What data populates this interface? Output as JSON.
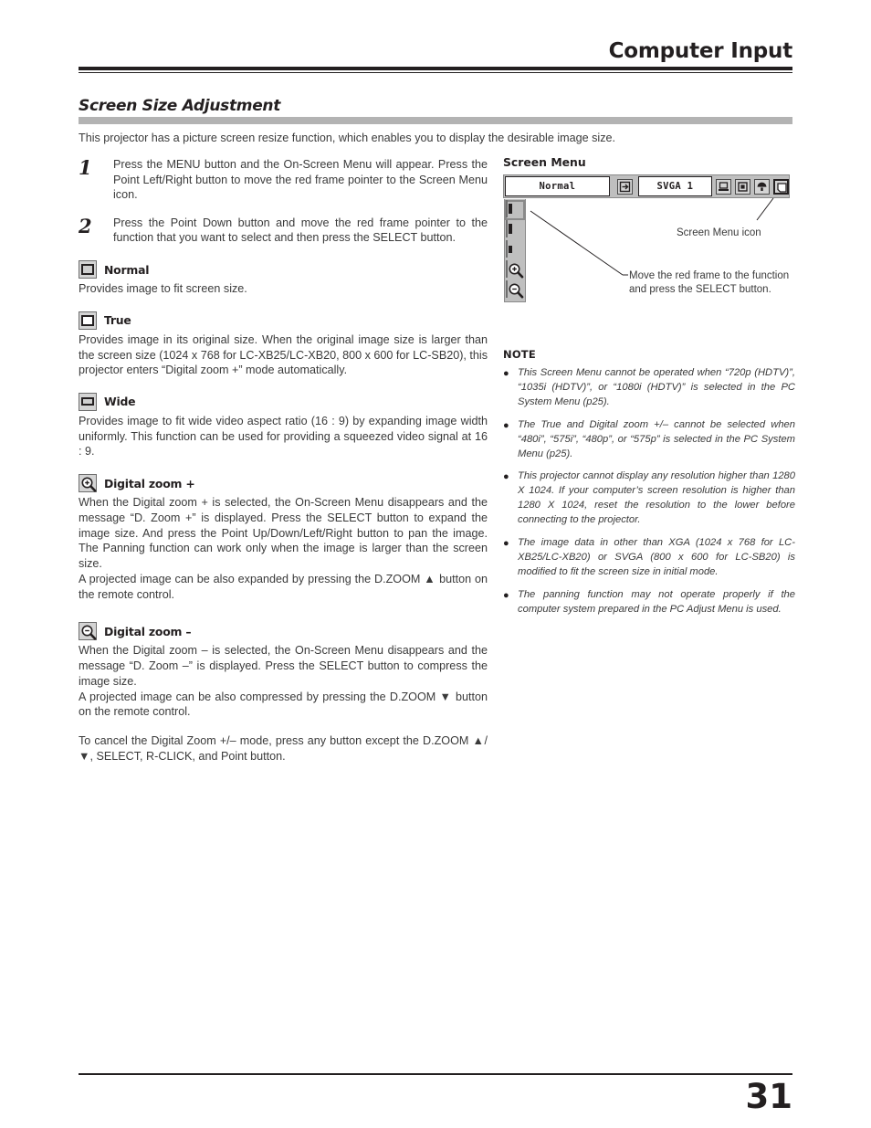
{
  "header": {
    "title": "Computer Input"
  },
  "section": {
    "title": "Screen Size Adjustment",
    "intro": "This projector has a picture screen resize function, which enables you to display the desirable image size."
  },
  "steps": [
    {
      "number": "1",
      "text": "Press the MENU button and the On-Screen Menu will appear. Press the Point Left/Right button to move the red frame pointer to the Screen Menu icon."
    },
    {
      "number": "2",
      "text": "Press the Point Down button and move the red frame pointer to the function that you want to select and then press the SELECT button."
    }
  ],
  "features": [
    {
      "icon": "screen-normal-icon",
      "name": "Normal",
      "paragraphs": [
        "Provides image to fit screen size."
      ]
    },
    {
      "icon": "screen-true-icon",
      "name": "True",
      "paragraphs": [
        "Provides image in its original size.  When the original image size is larger than the screen size (1024 x 768 for LC-XB25/LC-XB20, 800 x 600 for LC-SB20), this projector enters “Digital zoom +” mode automatically."
      ]
    },
    {
      "icon": "screen-wide-icon",
      "name": "Wide",
      "paragraphs": [
        "Provides image to fit wide video aspect ratio (16 : 9) by expanding image width uniformly.  This function can be used for providing a squeezed video signal at 16 : 9."
      ]
    },
    {
      "icon": "digital-zoom-plus-icon",
      "name": "Digital zoom +",
      "paragraphs": [
        "When the Digital zoom + is selected, the On-Screen Menu disappears and the message “D. Zoom +” is displayed.  Press the SELECT button to expand the image size.   And press the Point Up/Down/Left/Right button to pan the image.  The Panning function can work only when the image is larger than the screen size.",
        "A projected image can be also expanded by pressing the D.ZOOM ▲ button on the remote control."
      ]
    },
    {
      "icon": "digital-zoom-minus-icon",
      "name": "Digital zoom –",
      "paragraphs": [
        "When the Digital zoom – is selected, the On-Screen Menu disappears and the message “D. Zoom –” is displayed.  Press the SELECT button to compress the image size.",
        "A projected image can be also compressed by pressing the D.ZOOM ▼ button on the remote control."
      ]
    }
  ],
  "trailing_note": "To cancel the Digital Zoom +/– mode, press any button except the D.ZOOM ▲/▼, SELECT, R-CLICK, and Point button.",
  "diagram": {
    "label": "Screen Menu",
    "mode_value": "Normal",
    "system_value": "SVGA 1",
    "bar_icons": [
      "input-source-icon",
      "pc-system-icon",
      "image-select-icon",
      "image-adjust-icon",
      "screen-menu-icon"
    ],
    "strip_icons": [
      "screen-normal-icon",
      "screen-true-icon",
      "screen-wide-icon",
      "digital-zoom-plus-icon",
      "digital-zoom-minus-icon"
    ],
    "callout_menu_icon": "Screen Menu icon",
    "callout_move": "Move the red frame to the function and press the SELECT button."
  },
  "note": {
    "title": "NOTE",
    "bullet": "●",
    "items": [
      "This Screen Menu cannot be operated when “720p (HDTV)”, “1035i (HDTV)”, or “1080i (HDTV)” is selected in the PC System Menu  (p25).",
      "The True and Digital zoom +/– cannot be selected when “480i”, “575i”, “480p”, or “575p” is selected in the PC System Menu  (p25).",
      "This projector cannot display any resolution higher than 1280 X 1024.  If your computer’s screen resolution is higher than 1280 X 1024, reset the resolution to the lower before connecting to the projector.",
      "The image data in other than XGA (1024 x 768 for LC-XB25/LC-XB20) or SVGA (800 x 600 for LC-SB20) is modified to fit the screen size in initial mode.",
      "The panning function may not operate properly if the computer system prepared in the PC Adjust Menu is used."
    ]
  },
  "footer": {
    "page_number": "31"
  }
}
